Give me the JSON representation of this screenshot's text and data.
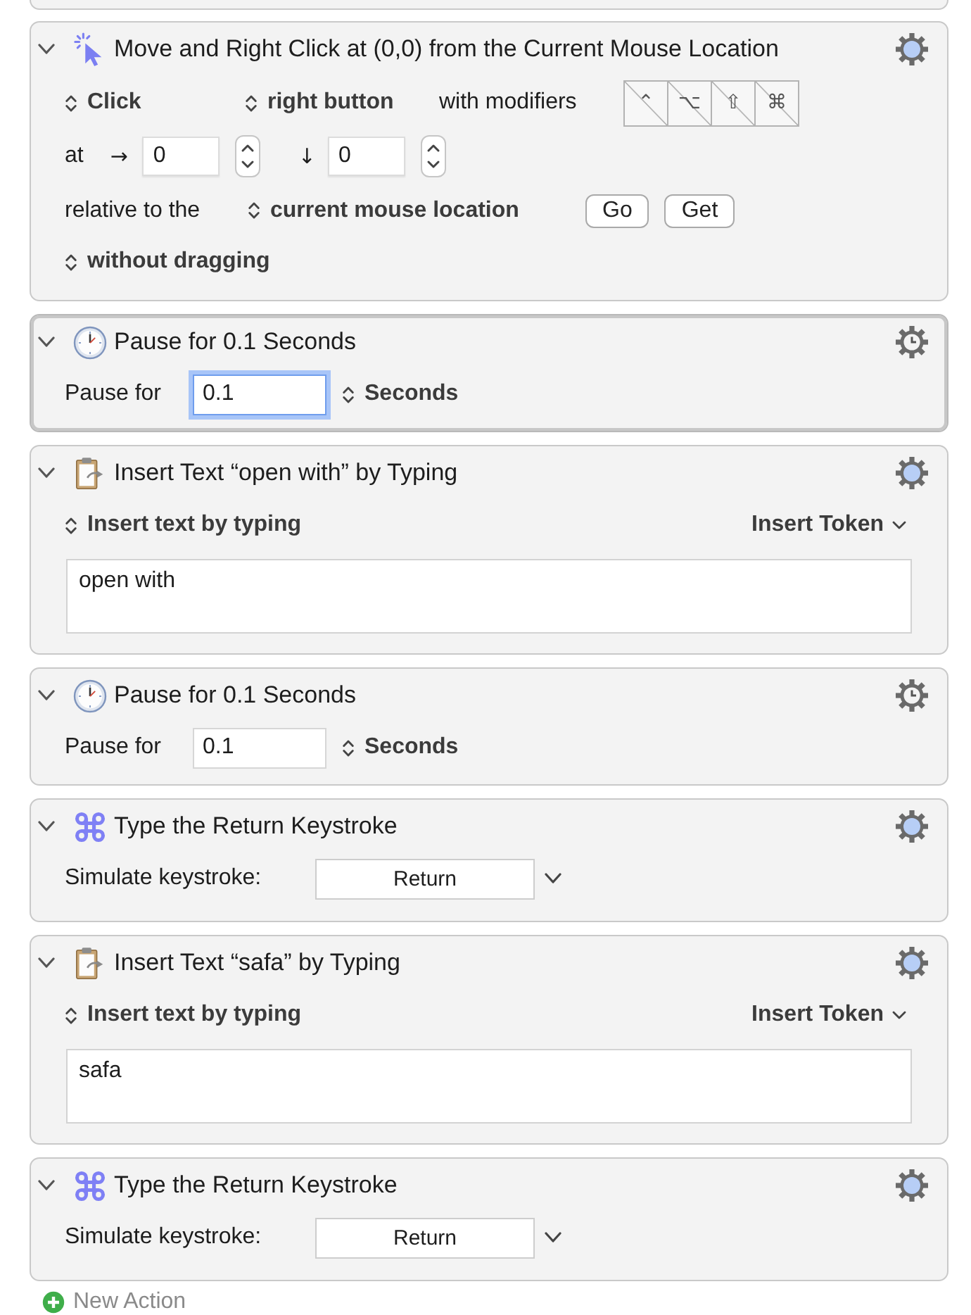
{
  "actions": [
    {
      "kind": "click",
      "title": "Move and Right Click at (0,0) from the Current Mouse Location",
      "expanded": true,
      "selected": false,
      "click_popup": "Click",
      "button_popup": "right button",
      "modifiers_label": "with modifiers",
      "modifiers": [
        {
          "symbol": "⌃",
          "on": false
        },
        {
          "symbol": "⌥",
          "on": false
        },
        {
          "symbol": "⇧",
          "on": false
        },
        {
          "symbol": "⌘",
          "on": false
        }
      ],
      "at_label": "at",
      "x_arrow": "→",
      "x_value": "0",
      "y_arrow": "↓",
      "y_value": "0",
      "relative_label": "relative to the",
      "relative_popup": "current mouse location",
      "buttons": [
        "Go",
        "Get"
      ],
      "drag_popup": "without dragging"
    },
    {
      "kind": "pause",
      "title": "Pause for 0.1 Seconds",
      "expanded": true,
      "selected": true,
      "label": "Pause for",
      "value": "0.1",
      "focused": true,
      "unit_popup": "Seconds"
    },
    {
      "kind": "insert_text",
      "title": "Insert Text “open with” by Typing",
      "expanded": true,
      "selected": false,
      "mode_popup": "Insert text by typing",
      "token_menu": "Insert Token",
      "text": "open with"
    },
    {
      "kind": "pause",
      "title": "Pause for 0.1 Seconds",
      "expanded": true,
      "selected": false,
      "label": "Pause for",
      "value": "0.1",
      "focused": false,
      "unit_popup": "Seconds"
    },
    {
      "kind": "keystroke",
      "title": "Type the Return Keystroke",
      "expanded": true,
      "selected": false,
      "label": "Simulate keystroke:",
      "key": "Return"
    },
    {
      "kind": "insert_text",
      "title": "Insert Text “safa” by Typing",
      "expanded": true,
      "selected": false,
      "mode_popup": "Insert text by typing",
      "token_menu": "Insert Token",
      "text": "safa"
    },
    {
      "kind": "keystroke",
      "title": "Type the Return Keystroke",
      "expanded": true,
      "selected": false,
      "label": "Simulate keystroke:",
      "key": "Return"
    }
  ],
  "new_action": {
    "label": "New Action"
  }
}
